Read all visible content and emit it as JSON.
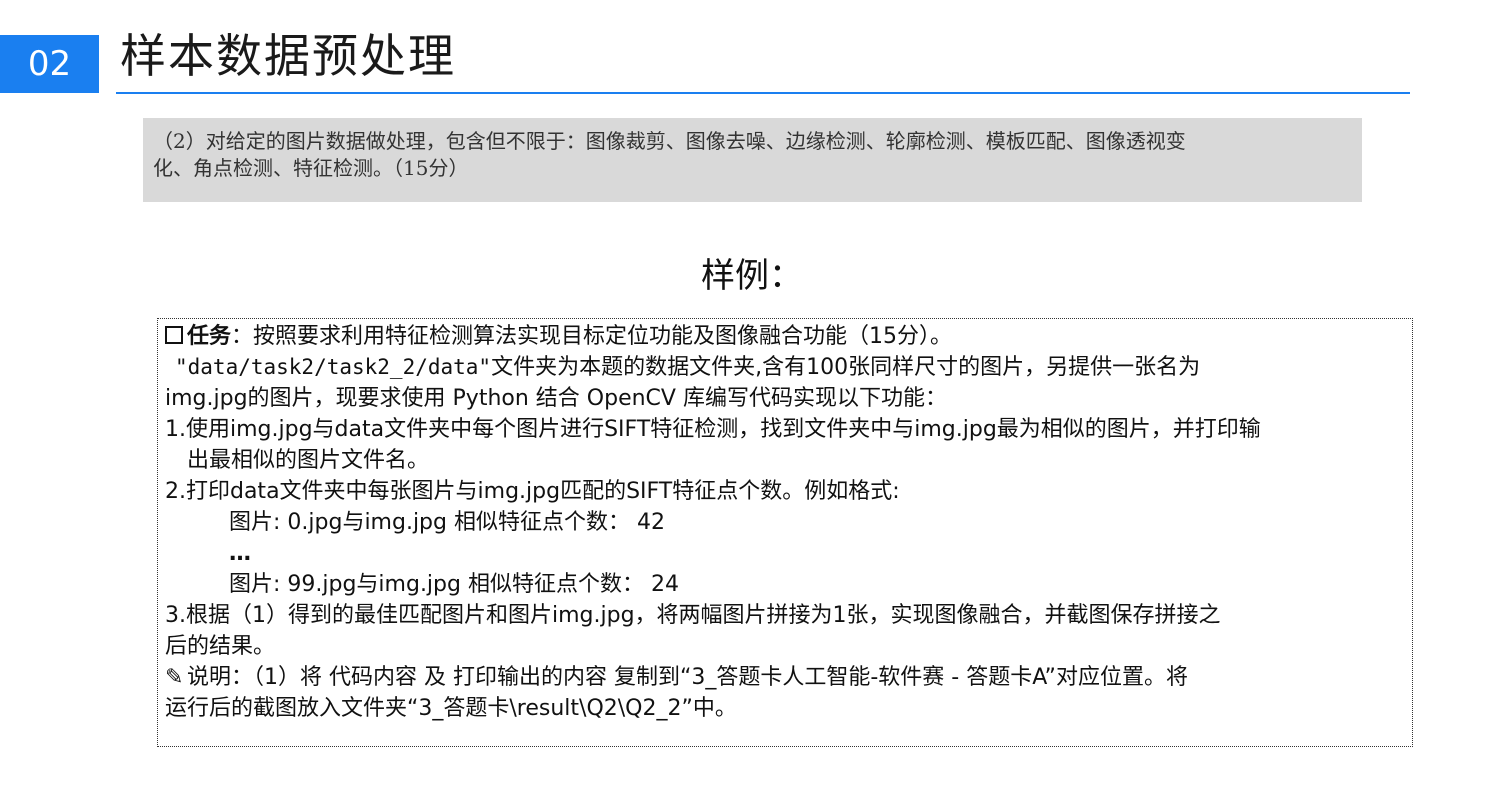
{
  "header": {
    "section_number": "02",
    "title": "样本数据预处理"
  },
  "requirement": {
    "line1": "（2）对给定的图片数据做处理，包含但不限于：图像裁剪、图像去噪、边缘检测、轮廓检测、模板匹配、图像透视变",
    "line2": "化、角点检测、特征检测。（15分）"
  },
  "sample_heading": "样例：",
  "task": {
    "label": "任务",
    "colon": "：",
    "intro": "按照要求利用特征检测算法实现目标定位功能及图像融合功能（15分）。",
    "folder_path": "\"data/task2/task2_2/data\"",
    "desc1_rest": "文件夹为本题的数据文件夹,含有100张同样尺寸的图片，另提供一张名为",
    "desc2": "img.jpg的图片，现要求使用 Python 结合 OpenCV 库编写代码实现以下功能：",
    "item1_line1": "1.使用img.jpg与data文件夹中每个图片进行SIFT特征检测，找到文件夹中与img.jpg最为相似的图片，并打印输",
    "item1_line2": "出最相似的图片文件名。",
    "item2": "2.打印data文件夹中每张图片与img.jpg匹配的SIFT特征点个数。例如格式:",
    "example1": "图片: 0.jpg与img.jpg 相似特征点个数：  42",
    "ellipsis": "…",
    "example2": "图片: 99.jpg与img.jpg 相似特征点个数：  24",
    "item3_line1": "3.根据（1）得到的最佳匹配图片和图片img.jpg，将两幅图片拼接为1张，实现图像融合，并截图保存拼接之",
    "item3_line2": "后的结果。",
    "note_line1": "说明：（1）将 代码内容 及 打印输出的内容 复制到“3_答题卡人工智能-软件赛 - 答题卡A”对应位置。将",
    "note_line2": "运行后的截图放入文件夹“3_答题卡\\result\\Q2\\Q2_2”中。"
  },
  "icons": {
    "checkbox": "checkbox-icon",
    "pencil": "pencil-icon"
  },
  "colors": {
    "accent": "#1a7ff0",
    "requirement_bg": "#d9d9d9"
  }
}
